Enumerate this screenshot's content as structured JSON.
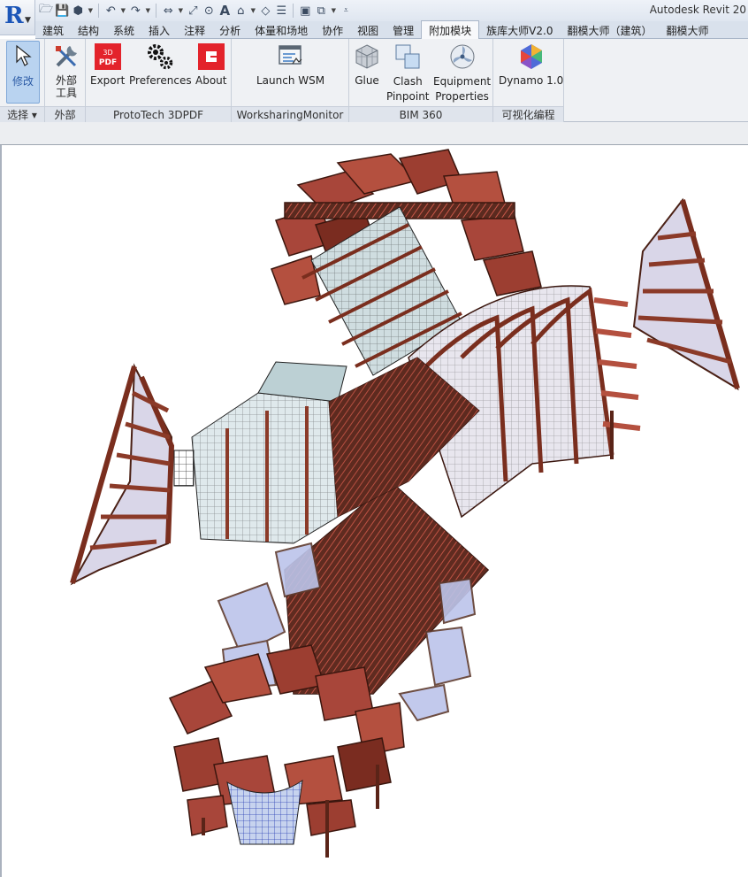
{
  "app": {
    "title": "Autodesk Revit 20"
  },
  "quick_access": [
    "open-icon",
    "save-icon",
    "sync-icon",
    "undo-icon",
    "redo-icon",
    "measure-icon",
    "dimension-icon",
    "tag-icon",
    "text-icon",
    "3d-view-icon",
    "section-icon",
    "thin-lines-icon",
    "close-hidden-icon",
    "switch-windows-icon",
    "customize-icon"
  ],
  "tabs": [
    {
      "label": "建筑"
    },
    {
      "label": "结构"
    },
    {
      "label": "系统"
    },
    {
      "label": "插入"
    },
    {
      "label": "注释"
    },
    {
      "label": "分析"
    },
    {
      "label": "体量和场地"
    },
    {
      "label": "协作"
    },
    {
      "label": "视图"
    },
    {
      "label": "管理"
    },
    {
      "label": "附加模块",
      "active": true
    },
    {
      "label": "族库大师V2.0"
    },
    {
      "label": "翻模大师（建筑）"
    },
    {
      "label": "翻模大师"
    }
  ],
  "ribbon": {
    "modify": {
      "label": "修改",
      "panel": "选择"
    },
    "external": {
      "label_line1": "外部",
      "label_line2": "工具",
      "panel": "外部"
    },
    "prototech": {
      "export": "Export",
      "preferences": "Preferences",
      "about": "About",
      "panel": "ProtoTech 3DPDF"
    },
    "wsm": {
      "launch": "Launch WSM",
      "panel": "WorksharingMonitor"
    },
    "bim360": {
      "glue": "Glue",
      "clash_1": "Clash",
      "clash_2": "Pinpoint",
      "equip_1": "Equipment",
      "equip_2": "Properties",
      "panel": "BIM 360"
    },
    "dynamo": {
      "label": "Dynamo 1.0",
      "panel": "可视化编程"
    }
  },
  "colors": {
    "accent_red": "#8b3a28",
    "facade_blue": "#b9c2e8",
    "tab_active": "#f8f9fb"
  },
  "canvas": {
    "content": "3D building model view"
  }
}
